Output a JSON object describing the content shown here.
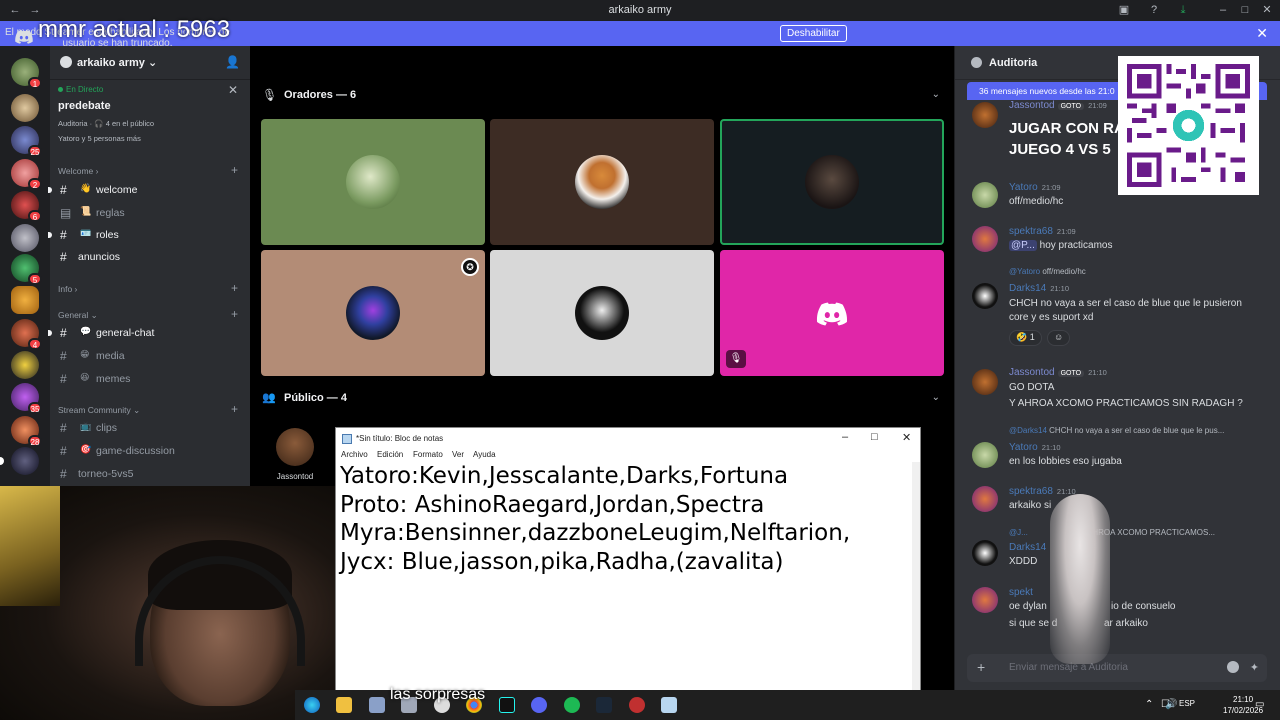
{
  "window": {
    "title": "arkaiko army"
  },
  "overlay": {
    "mmr": "mmr actual : 5963",
    "subtitle": "las sorpresas"
  },
  "banner": {
    "message": "El modo Streamer está habilitado. Los nombres de usuario se han truncado.",
    "button": "Deshabilitar"
  },
  "server": {
    "name": "arkaiko army",
    "server_badges": [
      "1",
      "",
      "25",
      "2",
      "6",
      "",
      "5",
      "",
      "4",
      "",
      "35",
      "28",
      ""
    ]
  },
  "live": {
    "tag": "En Directo",
    "title": "predebate",
    "meta": "Auditoria · 🎧 4 en el público",
    "users": "Yatoro y 5 personas más"
  },
  "categories": {
    "welcome": "Welcome",
    "info": "Info",
    "general": "General",
    "stream": "Stream Community"
  },
  "channels": {
    "welcome": "welcome",
    "reglas": "reglas",
    "roles": "roles",
    "anuncios": "anuncios",
    "general_chat": "general-chat",
    "media": "media",
    "memes": "memes",
    "clips": "clips",
    "game_discussion": "game-discussion",
    "torneo": "torneo-5vs5"
  },
  "stage": {
    "speakers_header": "Oradores — 6",
    "audience_header": "Público — 4",
    "audience": [
      {
        "name": "Jassontod"
      }
    ]
  },
  "notepad": {
    "title": "*Sin título: Bloc de notas",
    "menu": [
      "Archivo",
      "Edición",
      "Formato",
      "Ver",
      "Ayuda"
    ],
    "lines": [
      "Yatoro:Kevin,Jesscalante,Darks,Fortuna",
      "Proto: AshinoRaegard,Jordan,Spectra",
      "Myra:Bensinner,dazzboneLeugim,Nelftarion,",
      "Jycx: Blue,jasson,pika,Radha,(zavalita)"
    ]
  },
  "chat": {
    "title": "Auditoria",
    "new_messages": "36 mensajes nuevos desde las 21:0",
    "pinned_big": [
      "JUGAR CON RA",
      "JUEGO 4 VS 5"
    ],
    "composer_placeholder": "Enviar mensaje a Auditoria",
    "messages": [
      {
        "author": "Jassontod",
        "time": "21:09",
        "tag": "GOTO"
      },
      {
        "author": "Yatoro",
        "time": "21:09",
        "text": "off/medio/hc"
      },
      {
        "author": "spektra68",
        "time": "21:09",
        "mention": "@P...",
        "text": "hoy practicamos"
      },
      {
        "reply_author": "@Yatoro",
        "reply": "off/medio/hc",
        "author": "Darks14",
        "time": "21:10",
        "text": "CHCH no vaya a ser el caso de blue que le pusieron",
        "text2": "core y es suport xd",
        "reaction_count": "1"
      },
      {
        "author": "Jassontod",
        "time": "21:10",
        "tag": "GOTO",
        "text": "GO DOTA",
        "text2": "Y AHROA XCOMO PRACTICAMOS SIN RADAGH ?"
      },
      {
        "reply_author": "@Darks14",
        "reply": "CHCH no vaya a ser el caso de blue que le pus...",
        "author": "Yatoro",
        "time": "21:10",
        "text": "en los lobbies eso jugaba"
      },
      {
        "author": "spektra68",
        "time": "21:10",
        "text": "arkaiko si"
      },
      {
        "reply_author": "@J...",
        "reply": "Y AHROA XCOMO PRACTICAMOS...",
        "author": "Darks14",
        "time": "",
        "text": "XDDD"
      },
      {
        "author": "spekt",
        "time": "",
        "text": "oe dylan",
        "text_right": "io de consuelo",
        "text2": "si que se d",
        "text2_right": "ar arkaiko"
      }
    ]
  },
  "taskbar": {
    "lang": "ESP",
    "time": "21:10",
    "date": "17/02/2026"
  },
  "colors": {
    "blurple": "#5865f2",
    "online": "#23a55a",
    "tile_green": "#6b8a52",
    "tile_brown": "#3d2c24",
    "tile_tan": "#b38c76",
    "tile_gray": "#d8d8d8",
    "tile_pink": "#e026a8"
  }
}
